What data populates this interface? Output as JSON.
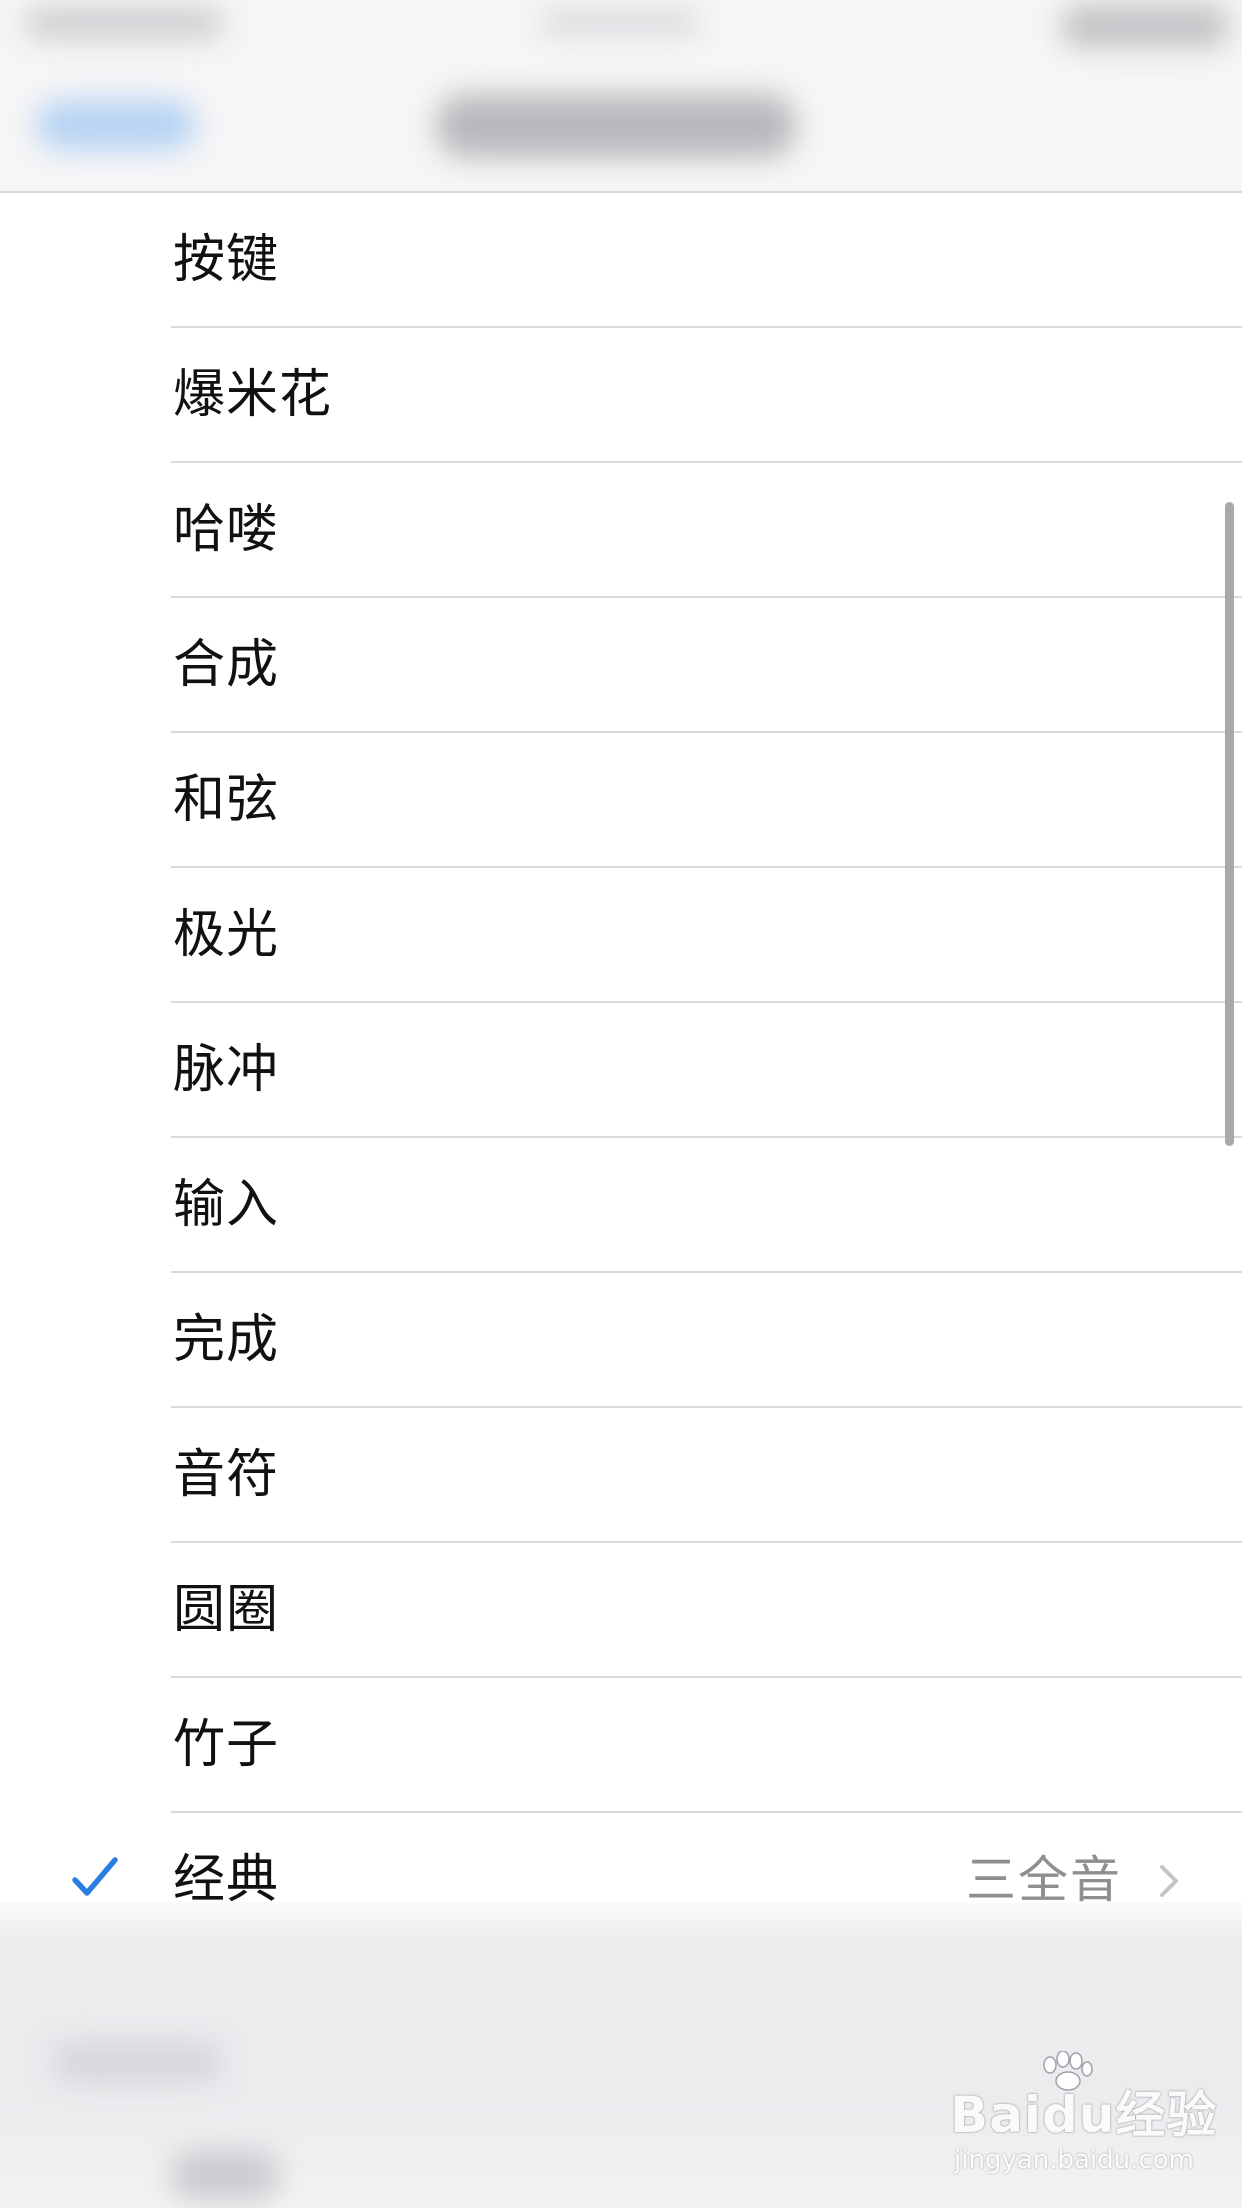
{
  "list": {
    "items": [
      {
        "label": "按键"
      },
      {
        "label": "爆米花"
      },
      {
        "label": "哈喽"
      },
      {
        "label": "合成"
      },
      {
        "label": "和弦"
      },
      {
        "label": "极光"
      },
      {
        "label": "脉冲"
      },
      {
        "label": "输入"
      },
      {
        "label": "完成"
      },
      {
        "label": "音符"
      },
      {
        "label": "圆圈"
      },
      {
        "label": "竹子"
      },
      {
        "label": "经典",
        "selected": true,
        "detail": "三全音"
      }
    ]
  },
  "icons": {
    "check": "checkmark-icon",
    "chevron": "chevron-right-icon"
  },
  "colors": {
    "accent": "#2a7de1",
    "secondary_text": "#8e8e93",
    "separator": "#dadadd"
  },
  "watermark": {
    "brand": "Baidu经验",
    "url": "jingyan.baidu.com"
  }
}
